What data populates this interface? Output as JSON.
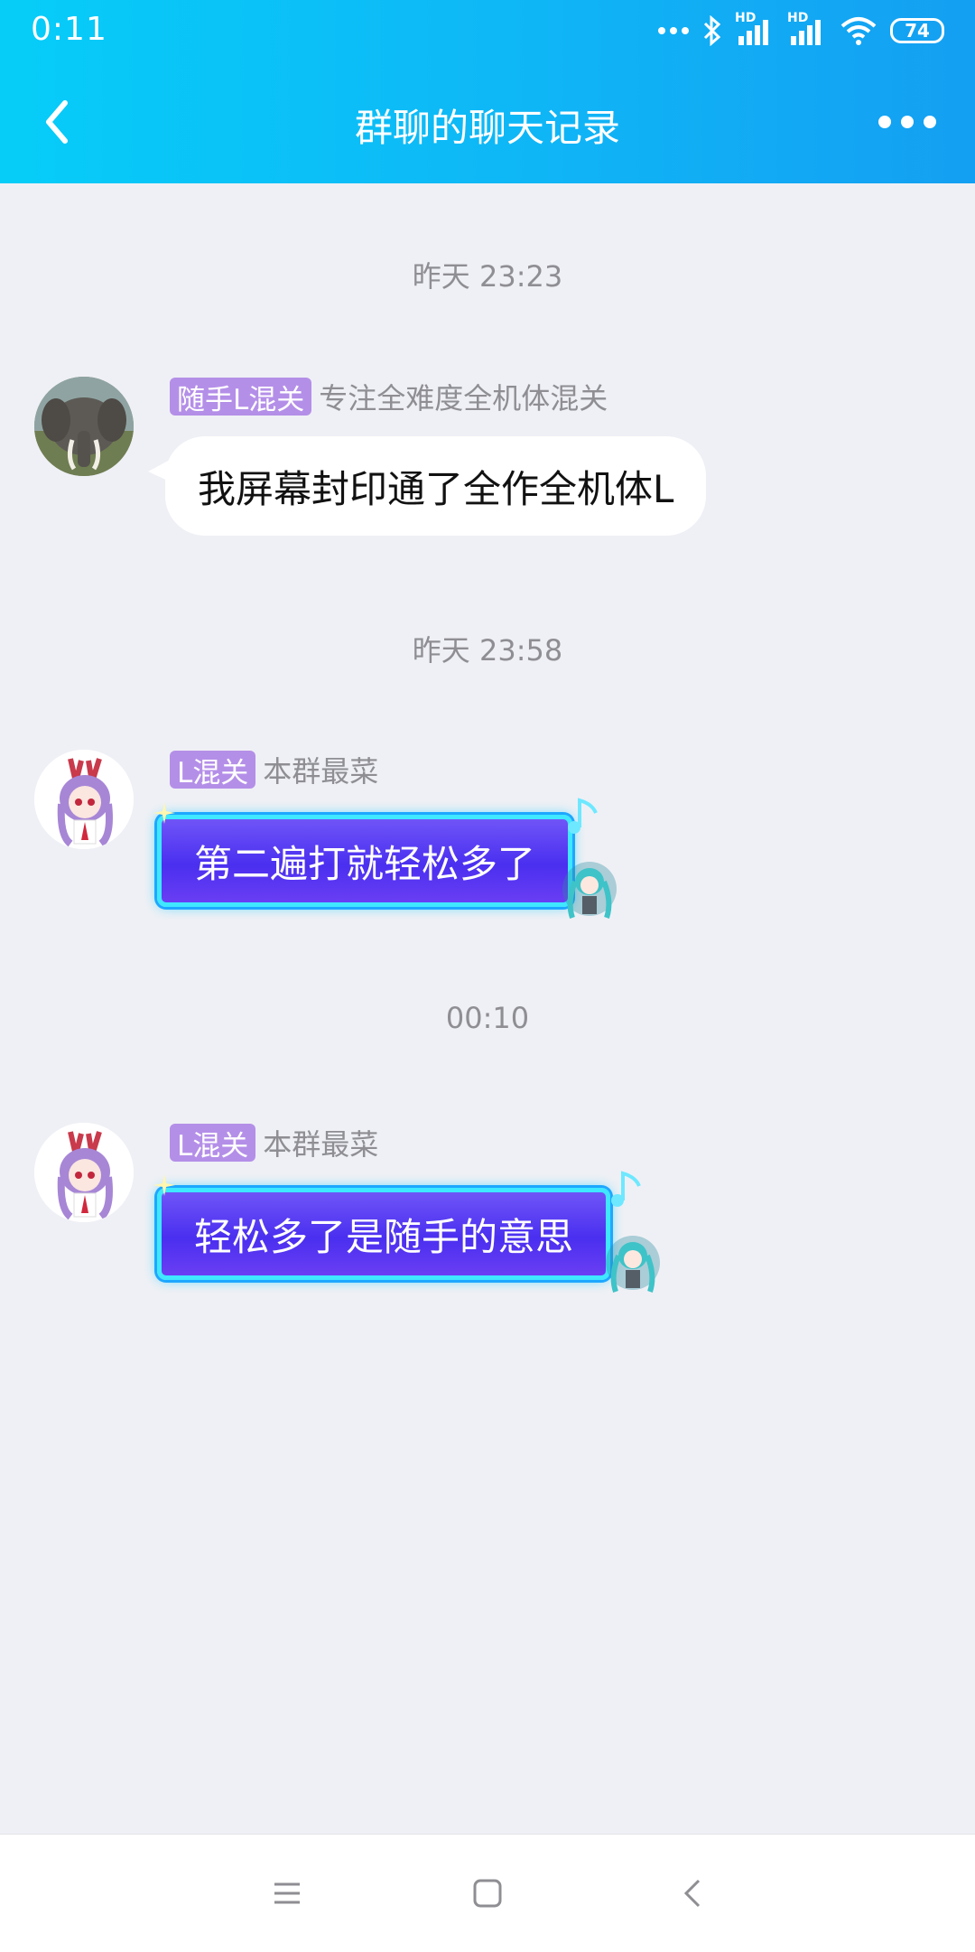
{
  "status_bar": {
    "time": "0:11",
    "battery": "74",
    "signal_label_1": "HD",
    "signal_label_2": "HD"
  },
  "header": {
    "title": "群聊的聊天记录"
  },
  "messages": [
    {
      "time": "昨天 23:23",
      "badge": "随手L混关",
      "sender": "专注全难度全机体混关",
      "text": "我屏幕封印通了全作全机体L"
    },
    {
      "time": "昨天 23:58",
      "badge": "L混关",
      "sender": "本群最菜",
      "text": "第二遍打就轻松多了"
    },
    {
      "time": "00:10",
      "badge": "L混关",
      "sender": "本群最菜",
      "text": "轻松多了是随手的意思"
    }
  ],
  "colors": {
    "header_start": "#06cdf8",
    "header_end": "#149ff2",
    "badge": "#b48fe8",
    "background": "#eff0f5"
  },
  "icons": [
    "back-arrow-icon",
    "more-icon",
    "menu-icon",
    "home-icon",
    "back-icon",
    "bluetooth-icon",
    "signal-icon",
    "wifi-icon"
  ]
}
